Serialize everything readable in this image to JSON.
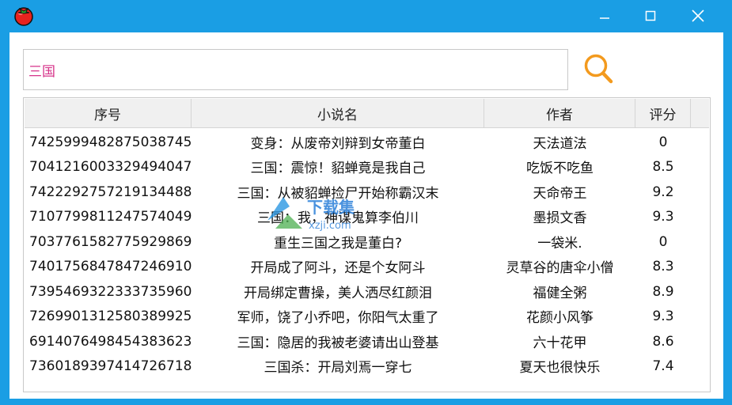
{
  "search": {
    "value": "三国"
  },
  "table": {
    "headers": [
      "序号",
      "小说名",
      "作者",
      "评分"
    ],
    "rows": [
      [
        "7425999482875038745",
        "变身：从废帝刘辩到女帝董白",
        "天法道法",
        "0"
      ],
      [
        "7041216003329494047",
        "三国：震惊！貂蝉竟是我自己",
        "吃饭不吃鱼",
        "8.5"
      ],
      [
        "7422292757219134488",
        "三国：从被貂蝉捡尸开始称霸汉末",
        "天命帝王",
        "9.2"
      ],
      [
        "7107799811247574049",
        "三国：我，神谋鬼算李伯川",
        "墨损文香",
        "9.3"
      ],
      [
        "7037761582775929869",
        "重生三国之我是董白?",
        "一袋米.",
        "0"
      ],
      [
        "7401756847847246910",
        "开局成了阿斗，还是个女阿斗",
        "灵草谷的唐伞小僧",
        "8.3"
      ],
      [
        "7395469322333735960",
        "开局绑定曹操，美人洒尽红颜泪",
        "福健全粥",
        "8.9"
      ],
      [
        "7269901312580389925",
        "军师，饶了小乔吧，你阳气太重了",
        "花颜小风筝",
        "9.3"
      ],
      [
        "6914076498454383623",
        "三国：隐居的我被老婆请出山登基",
        "六十花甲",
        "8.6"
      ],
      [
        "7360189397414726718",
        "三国杀：开局刘焉一穿七",
        "夏天也很快乐",
        "7.4"
      ]
    ]
  },
  "watermark": {
    "text": "下载集",
    "url": "xzji.com"
  },
  "colors": {
    "titlebar": "#1a9ee4",
    "search_text": "#d6338a",
    "search_icon": "#f39a1e"
  },
  "icons": {
    "app": "tomato-icon",
    "search": "magnifier-icon"
  }
}
